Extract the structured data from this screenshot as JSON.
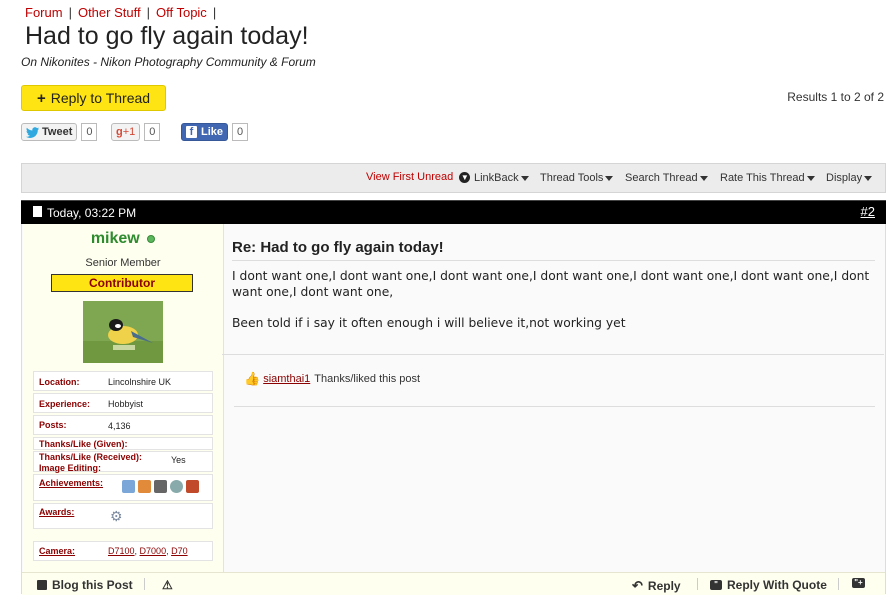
{
  "breadcrumb": [
    "Forum",
    "Other Stuff",
    "Off Topic"
  ],
  "thread": {
    "title": "Had to go fly again today!",
    "subtitle": "On Nikonites - Nikon Photography Community & Forum"
  },
  "reply_button": "Reply to Thread",
  "results": "Results 1 to 2 of 2",
  "social": {
    "tweet": "Tweet",
    "tweet_count": "0",
    "gplus": "+1",
    "gplus_count": "0",
    "like": "Like",
    "like_count": "0"
  },
  "toolbar": {
    "view_first_unread": "View First Unread",
    "linkback": "LinkBack",
    "thread_tools": "Thread Tools",
    "search_thread": "Search Thread",
    "rate_thread": "Rate This Thread",
    "display": "Display"
  },
  "post": {
    "date": "Today, 03:22 PM",
    "number": "#2",
    "username": "mikew",
    "user_title": "Senior Member",
    "badge": "Contributor",
    "fields": {
      "location_label": "Location:",
      "location": "Lincolnshire UK",
      "experience_label": "Experience:",
      "experience": "Hobbyist",
      "posts_label": "Posts:",
      "posts": "4,136",
      "thanks_given_label": "Thanks/Like (Given):",
      "thanks_received_label": "Thanks/Like (Received):",
      "image_editing_label": "Image Editing:",
      "image_editing": "Yes",
      "achievements_label": "Achievements:",
      "awards_label": "Awards:",
      "camera_label": "Camera:",
      "cameras": [
        "D7100",
        "D7000",
        "D70"
      ]
    },
    "subject": "Re: Had to go fly again today!",
    "body_line1": "I dont want one,I dont want one,I dont want one,I dont want one,I dont want one,I dont want one,I dont want one,I dont want one,",
    "body_line2": "Been told if i say it often enough i will believe it,not working yet",
    "thanks_user": "siamthai1",
    "thanks_text": "Thanks/liked this post"
  },
  "footer": {
    "blog": "Blog this Post",
    "reply": "Reply",
    "reply_quote": "Reply With Quote"
  },
  "colors": {
    "accent": "#c00000",
    "button": "#ffe413",
    "online": "#5cb85c",
    "username": "#2e8b2e"
  }
}
